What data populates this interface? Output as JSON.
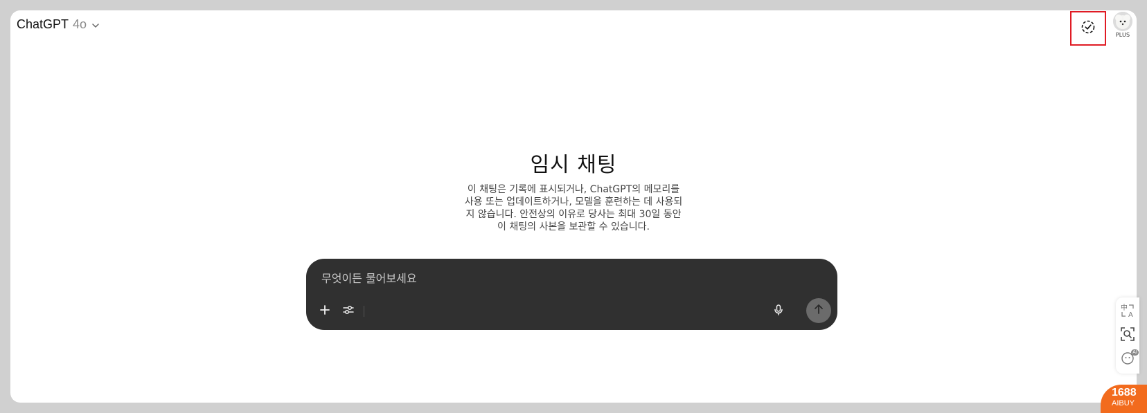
{
  "header": {
    "model_name": "ChatGPT",
    "model_version": "4o",
    "plan_badge": "PLUS"
  },
  "main": {
    "title": "임시 채팅",
    "description": "이 채팅은 기록에 표시되거나, ChatGPT의 메모리를 사용 또는 업데이트하거나, 모델을 훈련하는 데 사용되지 않습니다. 안전상의 이유로 당사는 최대 30일 동안 이 채팅의 사본을 보관할 수 있습니다."
  },
  "composer": {
    "placeholder": "무엇이든 물어보세요",
    "value": ""
  },
  "icons": {
    "model_chevron": "chevron-down-icon",
    "temp_chat": "dashed-circle-check-icon",
    "add": "plus-icon",
    "tools": "sliders-icon",
    "voice": "microphone-icon",
    "send": "arrow-up-icon",
    "translate": "translate-icon",
    "image_search": "image-search-icon",
    "ai_assistant": "ai-assistant-icon"
  },
  "extension": {
    "ai_tag": "AI",
    "brand_number": "1688",
    "brand_name": "AIBUY"
  },
  "colors": {
    "composer_bg": "#303030",
    "send_button_bg": "#6b6b6b",
    "highlight_border": "#e01b24",
    "brand_orange": "#f26b1d"
  }
}
